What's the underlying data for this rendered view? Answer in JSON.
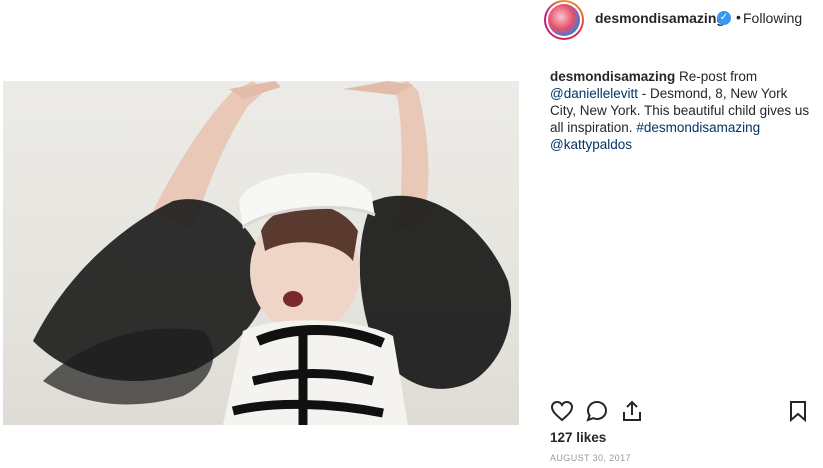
{
  "post": {
    "image_alt": "Child in white sailor hat and black tulle outfit with arms raised"
  },
  "header": {
    "username": "desmondisamazing",
    "separator": "•",
    "follow_status": "Following"
  },
  "caption": {
    "username": "desmondisamazing",
    "text_1": "Re-post from",
    "mention_1": "@daniellelevitt",
    "text_2": "- Desmond, 8, New York City, New York. This beautiful child gives us all inspiration.",
    "hashtag": "#desmondisamazing",
    "mention_2": "@kattypaldos"
  },
  "actions": {
    "icons": [
      "heart-icon",
      "comment-icon",
      "share-icon",
      "bookmark-icon"
    ]
  },
  "likes": "127 likes",
  "date": "AUGUST 30, 2017",
  "colors": {
    "link": "#003569",
    "verified": "#3897f0",
    "text": "#262626",
    "muted": "#999999"
  }
}
